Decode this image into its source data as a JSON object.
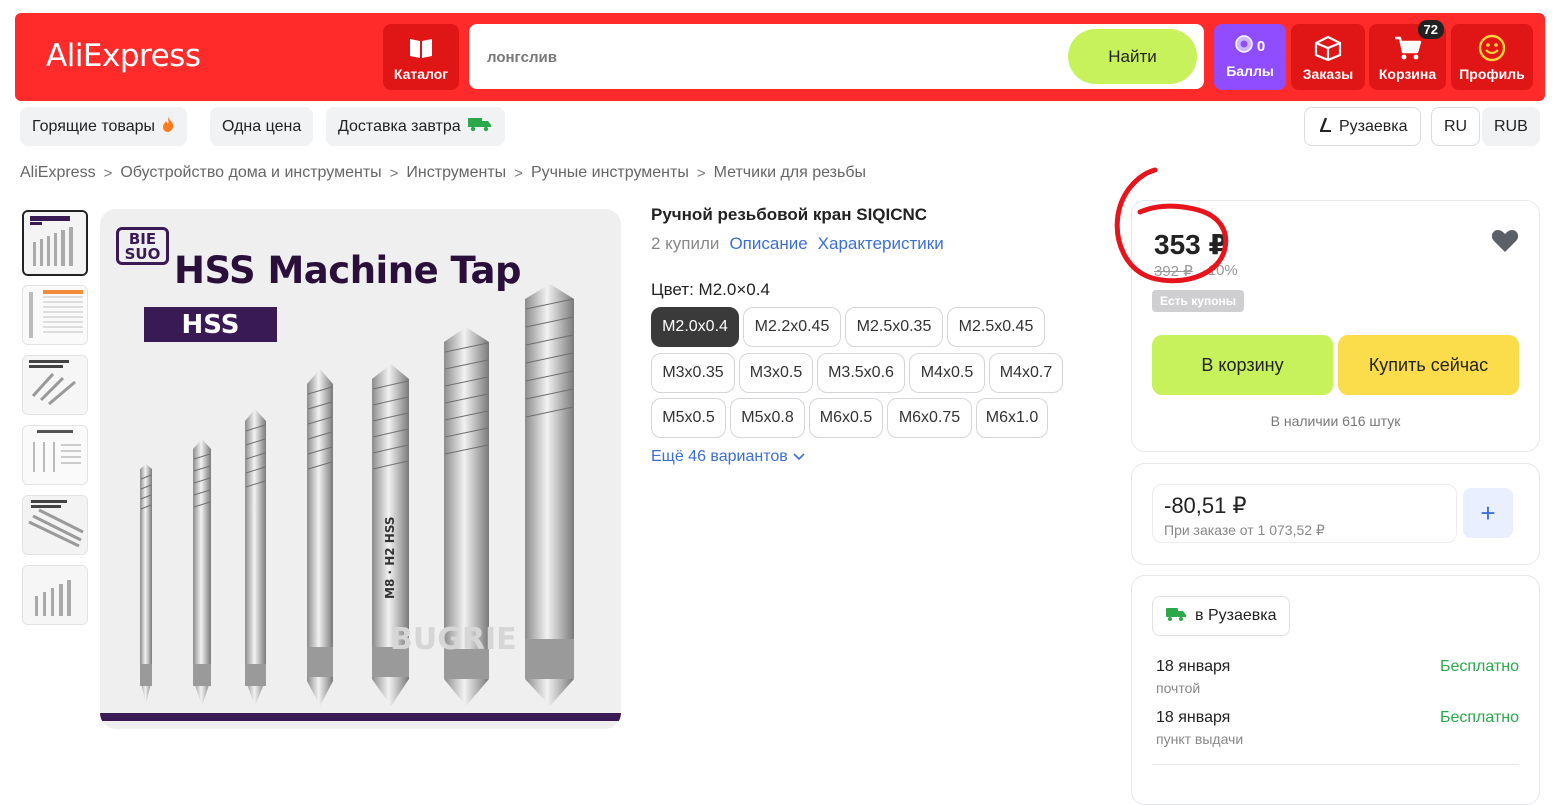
{
  "header": {
    "logo": "AliExpress",
    "catalog": "Каталог",
    "search_placeholder": "лонгслив",
    "search_button": "Найти",
    "points_count": "0",
    "points_label": "Баллы",
    "orders": "Заказы",
    "cart": "Корзина",
    "cart_count": "72",
    "profile": "Профиль"
  },
  "subnav": {
    "hot": "Горящие товары",
    "one_price": "Одна цена",
    "delivery_tomorrow": "Доставка завтра",
    "city": "Рузаевка",
    "lang": "RU",
    "currency": "RUB"
  },
  "breadcrumb": [
    "AliExpress",
    "Обустройство дома и инструменты",
    "Инструменты",
    "Ручные инструменты",
    "Метчики для резьбы"
  ],
  "gallery": {
    "brand_line1": "BIE",
    "brand_line2": "SUO",
    "title": "HSS Machine Tap",
    "label": "HSS",
    "shank_text": "M8 · H2 HSS",
    "watermark": "BUGRIE"
  },
  "product": {
    "title": "Ручной резьбовой кран SIQICNC",
    "sold": "2 купили",
    "description_link": "Описание",
    "specs_link": "Характеристики",
    "color_label": "Цвет: M2.0×0.4",
    "options": [
      "M2.0x0.4",
      "M2.2x0.45",
      "M2.5x0.35",
      "M2.5x0.45",
      "M3x0.35",
      "M3x0.5",
      "M3.5x0.6",
      "M4x0.5",
      "M4x0.7",
      "M5x0.5",
      "M5x0.8",
      "M6x0.5",
      "M6x0.75",
      "M6x1.0"
    ],
    "more_variants": "Ещё 46 вариантов"
  },
  "buy": {
    "price": "353 ₽",
    "old_price": "392 ₽",
    "discount": "-10%",
    "coupons": "Есть купоны",
    "add_to_cart": "В корзину",
    "buy_now": "Купить сейчас",
    "stock": "В наличии 616 штук"
  },
  "promo": {
    "amount": "-80,51 ₽",
    "note": "При заказе от 1 073,52 ₽",
    "plus": "+"
  },
  "delivery": {
    "city_chip": "в Рузаевка",
    "rows": [
      {
        "date": "18 января",
        "method": "почтой",
        "price": "Бесплатно"
      },
      {
        "date": "18 января",
        "method": "пункт выдачи",
        "price": "Бесплатно"
      }
    ]
  },
  "colors": {
    "header_red": "#ff2b2b",
    "accent_green": "#c8f25c",
    "accent_yellow": "#fbdc4a",
    "link_blue": "#3b6fd6",
    "points_purple": "#8f4dff"
  }
}
